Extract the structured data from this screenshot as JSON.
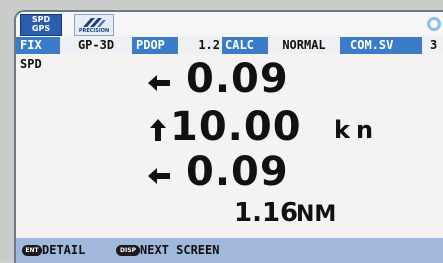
{
  "header": {
    "mode_icon": {
      "line1": "SPD",
      "line2": "GPS",
      "color": "#2a5fb0"
    },
    "brand_icon": {
      "label": "PRECISION",
      "icon": "precision-logo-icon"
    },
    "corner_icon": "status-ring-icon"
  },
  "status": {
    "fix_label": "FIX",
    "fix_value": "GP-3D",
    "pdop_label": "PDOP",
    "pdop_value": "1.2",
    "calc_label": "CALC",
    "calc_value": "NORMAL",
    "com_label": "COM.SV",
    "com_value": "3",
    "bar_color": "#3a7cc8"
  },
  "main": {
    "section_label": "SPD",
    "rows": [
      {
        "direction": "left-arrow-icon",
        "value": "0.09"
      },
      {
        "direction": "up-arrow-icon",
        "value": "10.00",
        "unit": "kn"
      },
      {
        "direction": "left-arrow-icon",
        "value": "0.09"
      }
    ],
    "distance": {
      "value": "1.16",
      "unit": "NM"
    }
  },
  "footer": {
    "detail_key": "ENT",
    "detail_label": "DETAIL",
    "next_key": "DISP",
    "next_label": "NEXT SCREEN",
    "bar_color": "#9fb8dc"
  }
}
